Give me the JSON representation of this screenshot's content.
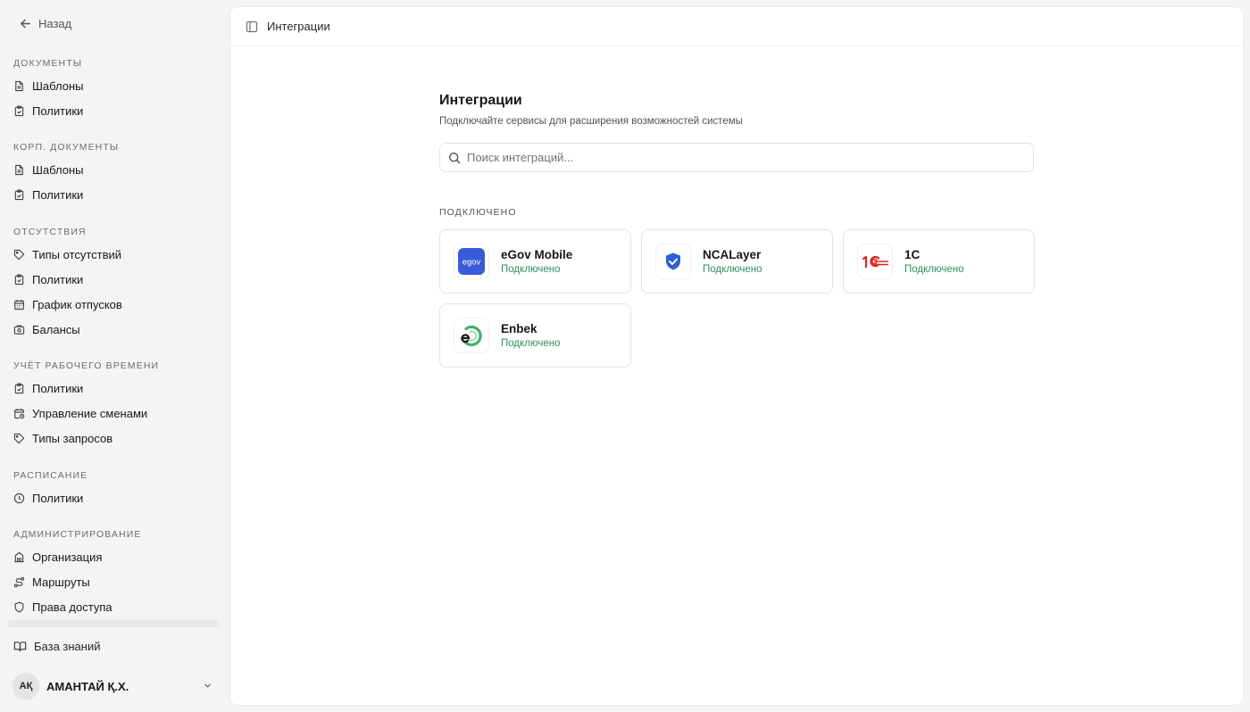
{
  "sidebar": {
    "back_label": "Назад",
    "sections": [
      {
        "title": "Документы",
        "items": [
          {
            "label": "Шаблоны",
            "icon": "document-icon"
          },
          {
            "label": "Политики",
            "icon": "clipboard-check-icon"
          }
        ]
      },
      {
        "title": "Корп. документы",
        "items": [
          {
            "label": "Шаблоны",
            "icon": "document-icon"
          },
          {
            "label": "Политики",
            "icon": "clipboard-check-icon"
          }
        ]
      },
      {
        "title": "Отсутствия",
        "items": [
          {
            "label": "Типы отсутствий",
            "icon": "tag-icon"
          },
          {
            "label": "Политики",
            "icon": "clipboard-check-icon"
          },
          {
            "label": "График отпусков",
            "icon": "calendar-icon"
          },
          {
            "label": "Балансы",
            "icon": "scale-icon"
          }
        ]
      },
      {
        "title": "Учёт рабочего времени",
        "items": [
          {
            "label": "Политики",
            "icon": "clipboard-check-icon"
          },
          {
            "label": "Управление сменами",
            "icon": "calendar-clock-icon"
          },
          {
            "label": "Типы запросов",
            "icon": "tag-icon"
          }
        ]
      },
      {
        "title": "Расписание",
        "items": [
          {
            "label": "Политики",
            "icon": "clock-icon"
          }
        ]
      },
      {
        "title": "Администрирование",
        "items": [
          {
            "label": "Организация",
            "icon": "building-icon"
          },
          {
            "label": "Маршруты",
            "icon": "route-icon"
          },
          {
            "label": "Права доступа",
            "icon": "shield-icon"
          }
        ]
      }
    ],
    "knowledge_base_label": "База знаний",
    "user": {
      "initials": "АҚ",
      "name": "АМАНТАЙ Қ.Х."
    }
  },
  "header": {
    "breadcrumb": "Интеграции"
  },
  "main": {
    "title": "Интеграции",
    "subtitle": "Подключайте сервисы для расширения возможностей системы",
    "search_placeholder": "Поиск интеграций...",
    "connected_label": "Подключено",
    "integrations": [
      {
        "name": "eGov Mobile",
        "status": "Подключено",
        "logo": "egov-logo"
      },
      {
        "name": "NCALayer",
        "status": "Подключено",
        "logo": "ncalayer-shield-logo"
      },
      {
        "name": "1С",
        "status": "Подключено",
        "logo": "1c-logo"
      },
      {
        "name": "Enbek",
        "status": "Подключено",
        "logo": "enbek-logo"
      }
    ]
  },
  "colors": {
    "accent_green": "#2f8f5b",
    "egov_blue": "#3a5bd9",
    "ncalayer_blue": "#2d5fd3",
    "onec_red": "#d8281f"
  }
}
